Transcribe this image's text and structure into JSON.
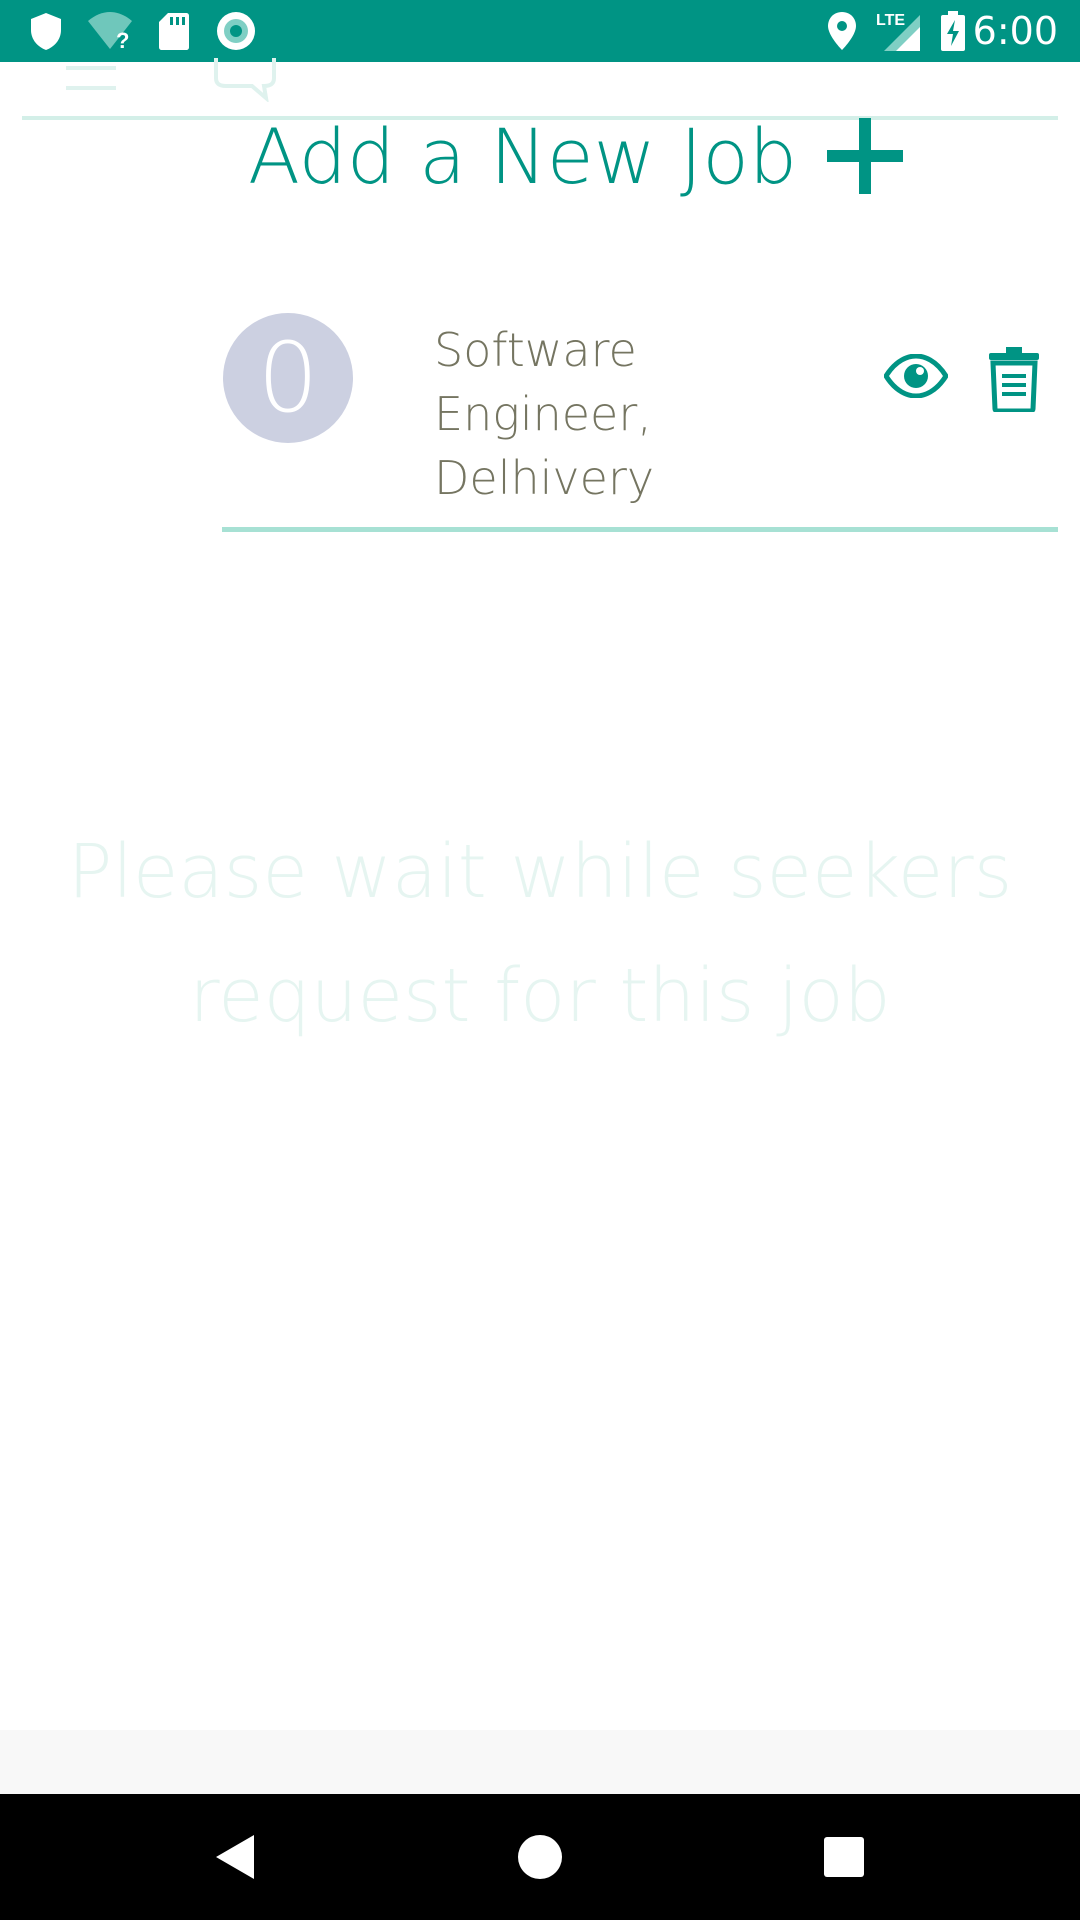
{
  "status_bar": {
    "time": "6:00",
    "network": "LTE",
    "background_color": "#009484",
    "icons": [
      "shield-icon",
      "wifi-unknown-icon",
      "sd-card-icon",
      "record-icon",
      "location-icon",
      "signal-icon",
      "battery-charging-icon"
    ]
  },
  "header": {
    "icons": [
      "menu-icon",
      "chat-icon"
    ]
  },
  "main": {
    "add_job_label": "Add a New Job",
    "add_job_icon": "plus-icon",
    "jobs": [
      {
        "count": "0",
        "title": "Software Engineer, Delhivery",
        "actions": [
          "eye-icon",
          "delete-icon"
        ]
      }
    ],
    "empty_message": "Please wait while seekers request for this job"
  },
  "colors": {
    "accent": "#009484",
    "job_title": "#757561",
    "count_circle": "#ccd0e1",
    "divider": "#a7e1d4",
    "faded_text": "#e6f5f1"
  },
  "nav_bar": {
    "icons": [
      "back-icon",
      "home-icon",
      "recents-icon"
    ]
  }
}
